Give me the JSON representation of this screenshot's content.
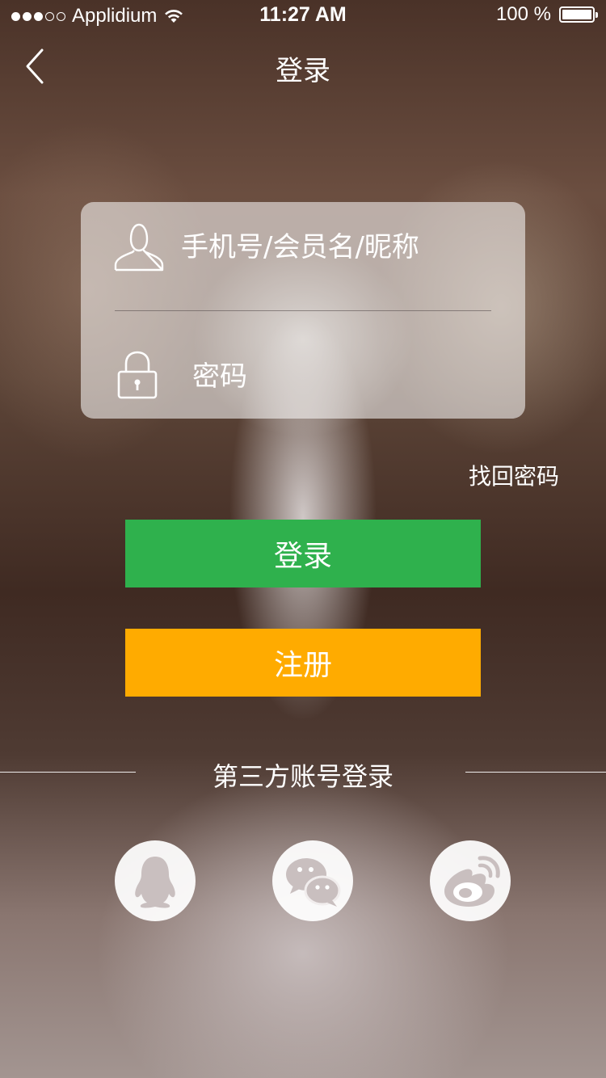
{
  "status_bar": {
    "carrier": "Applidium",
    "time": "11:27 AM",
    "battery": "100 %"
  },
  "nav": {
    "title": "登录",
    "back_icon": "chevron-left-icon"
  },
  "login_form": {
    "username_placeholder": "手机号/会员名/昵称",
    "username_icon": "user-icon",
    "password_placeholder": "密码",
    "password_icon": "lock-icon"
  },
  "forgot_password": "找回密码",
  "buttons": {
    "login": "登录",
    "register": "注册"
  },
  "colors": {
    "login_button": "#2fb14d",
    "register_button": "#ffab00"
  },
  "third_party": {
    "label": "第三方账号登录",
    "providers": [
      {
        "icon": "qq-icon"
      },
      {
        "icon": "wechat-icon"
      },
      {
        "icon": "weibo-icon"
      }
    ]
  }
}
